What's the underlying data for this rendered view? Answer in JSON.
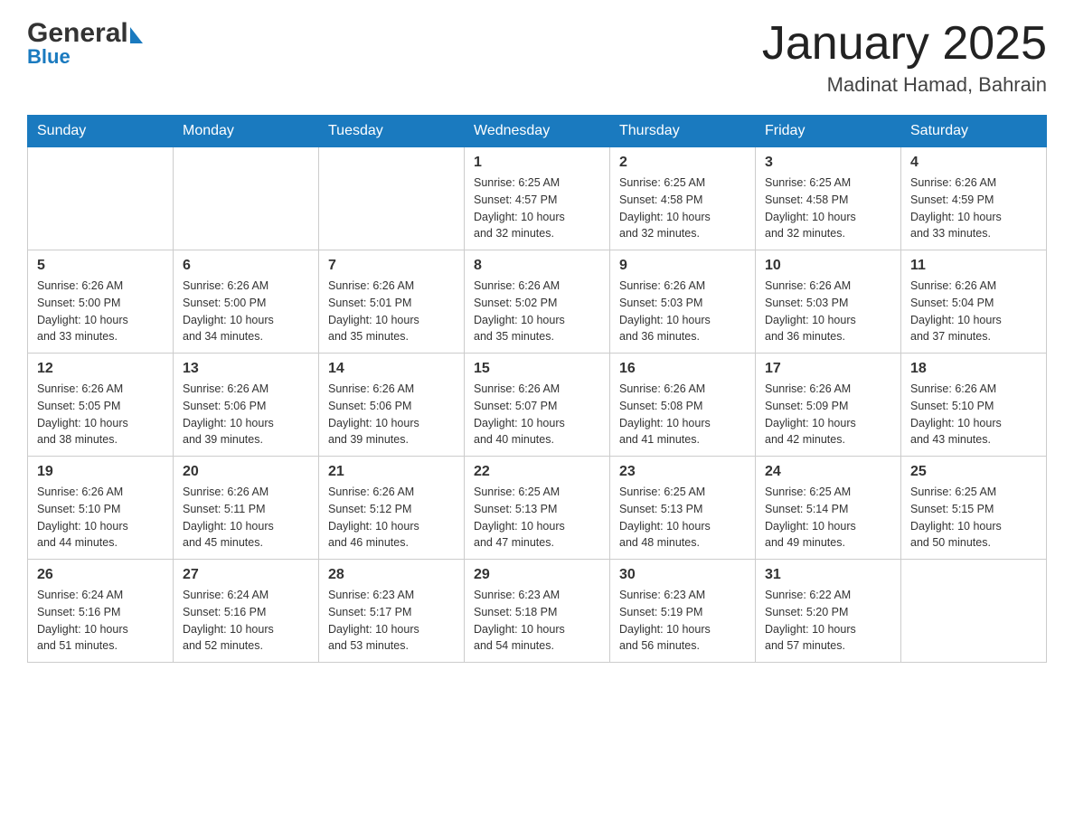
{
  "header": {
    "logo": {
      "general": "General",
      "blue": "Blue"
    },
    "title": "January 2025",
    "location": "Madinat Hamad, Bahrain"
  },
  "days": [
    "Sunday",
    "Monday",
    "Tuesday",
    "Wednesday",
    "Thursday",
    "Friday",
    "Saturday"
  ],
  "weeks": [
    [
      {
        "day": "",
        "info": ""
      },
      {
        "day": "",
        "info": ""
      },
      {
        "day": "",
        "info": ""
      },
      {
        "day": "1",
        "info": "Sunrise: 6:25 AM\nSunset: 4:57 PM\nDaylight: 10 hours\nand 32 minutes."
      },
      {
        "day": "2",
        "info": "Sunrise: 6:25 AM\nSunset: 4:58 PM\nDaylight: 10 hours\nand 32 minutes."
      },
      {
        "day": "3",
        "info": "Sunrise: 6:25 AM\nSunset: 4:58 PM\nDaylight: 10 hours\nand 32 minutes."
      },
      {
        "day": "4",
        "info": "Sunrise: 6:26 AM\nSunset: 4:59 PM\nDaylight: 10 hours\nand 33 minutes."
      }
    ],
    [
      {
        "day": "5",
        "info": "Sunrise: 6:26 AM\nSunset: 5:00 PM\nDaylight: 10 hours\nand 33 minutes."
      },
      {
        "day": "6",
        "info": "Sunrise: 6:26 AM\nSunset: 5:00 PM\nDaylight: 10 hours\nand 34 minutes."
      },
      {
        "day": "7",
        "info": "Sunrise: 6:26 AM\nSunset: 5:01 PM\nDaylight: 10 hours\nand 35 minutes."
      },
      {
        "day": "8",
        "info": "Sunrise: 6:26 AM\nSunset: 5:02 PM\nDaylight: 10 hours\nand 35 minutes."
      },
      {
        "day": "9",
        "info": "Sunrise: 6:26 AM\nSunset: 5:03 PM\nDaylight: 10 hours\nand 36 minutes."
      },
      {
        "day": "10",
        "info": "Sunrise: 6:26 AM\nSunset: 5:03 PM\nDaylight: 10 hours\nand 36 minutes."
      },
      {
        "day": "11",
        "info": "Sunrise: 6:26 AM\nSunset: 5:04 PM\nDaylight: 10 hours\nand 37 minutes."
      }
    ],
    [
      {
        "day": "12",
        "info": "Sunrise: 6:26 AM\nSunset: 5:05 PM\nDaylight: 10 hours\nand 38 minutes."
      },
      {
        "day": "13",
        "info": "Sunrise: 6:26 AM\nSunset: 5:06 PM\nDaylight: 10 hours\nand 39 minutes."
      },
      {
        "day": "14",
        "info": "Sunrise: 6:26 AM\nSunset: 5:06 PM\nDaylight: 10 hours\nand 39 minutes."
      },
      {
        "day": "15",
        "info": "Sunrise: 6:26 AM\nSunset: 5:07 PM\nDaylight: 10 hours\nand 40 minutes."
      },
      {
        "day": "16",
        "info": "Sunrise: 6:26 AM\nSunset: 5:08 PM\nDaylight: 10 hours\nand 41 minutes."
      },
      {
        "day": "17",
        "info": "Sunrise: 6:26 AM\nSunset: 5:09 PM\nDaylight: 10 hours\nand 42 minutes."
      },
      {
        "day": "18",
        "info": "Sunrise: 6:26 AM\nSunset: 5:10 PM\nDaylight: 10 hours\nand 43 minutes."
      }
    ],
    [
      {
        "day": "19",
        "info": "Sunrise: 6:26 AM\nSunset: 5:10 PM\nDaylight: 10 hours\nand 44 minutes."
      },
      {
        "day": "20",
        "info": "Sunrise: 6:26 AM\nSunset: 5:11 PM\nDaylight: 10 hours\nand 45 minutes."
      },
      {
        "day": "21",
        "info": "Sunrise: 6:26 AM\nSunset: 5:12 PM\nDaylight: 10 hours\nand 46 minutes."
      },
      {
        "day": "22",
        "info": "Sunrise: 6:25 AM\nSunset: 5:13 PM\nDaylight: 10 hours\nand 47 minutes."
      },
      {
        "day": "23",
        "info": "Sunrise: 6:25 AM\nSunset: 5:13 PM\nDaylight: 10 hours\nand 48 minutes."
      },
      {
        "day": "24",
        "info": "Sunrise: 6:25 AM\nSunset: 5:14 PM\nDaylight: 10 hours\nand 49 minutes."
      },
      {
        "day": "25",
        "info": "Sunrise: 6:25 AM\nSunset: 5:15 PM\nDaylight: 10 hours\nand 50 minutes."
      }
    ],
    [
      {
        "day": "26",
        "info": "Sunrise: 6:24 AM\nSunset: 5:16 PM\nDaylight: 10 hours\nand 51 minutes."
      },
      {
        "day": "27",
        "info": "Sunrise: 6:24 AM\nSunset: 5:16 PM\nDaylight: 10 hours\nand 52 minutes."
      },
      {
        "day": "28",
        "info": "Sunrise: 6:23 AM\nSunset: 5:17 PM\nDaylight: 10 hours\nand 53 minutes."
      },
      {
        "day": "29",
        "info": "Sunrise: 6:23 AM\nSunset: 5:18 PM\nDaylight: 10 hours\nand 54 minutes."
      },
      {
        "day": "30",
        "info": "Sunrise: 6:23 AM\nSunset: 5:19 PM\nDaylight: 10 hours\nand 56 minutes."
      },
      {
        "day": "31",
        "info": "Sunrise: 6:22 AM\nSunset: 5:20 PM\nDaylight: 10 hours\nand 57 minutes."
      },
      {
        "day": "",
        "info": ""
      }
    ]
  ]
}
